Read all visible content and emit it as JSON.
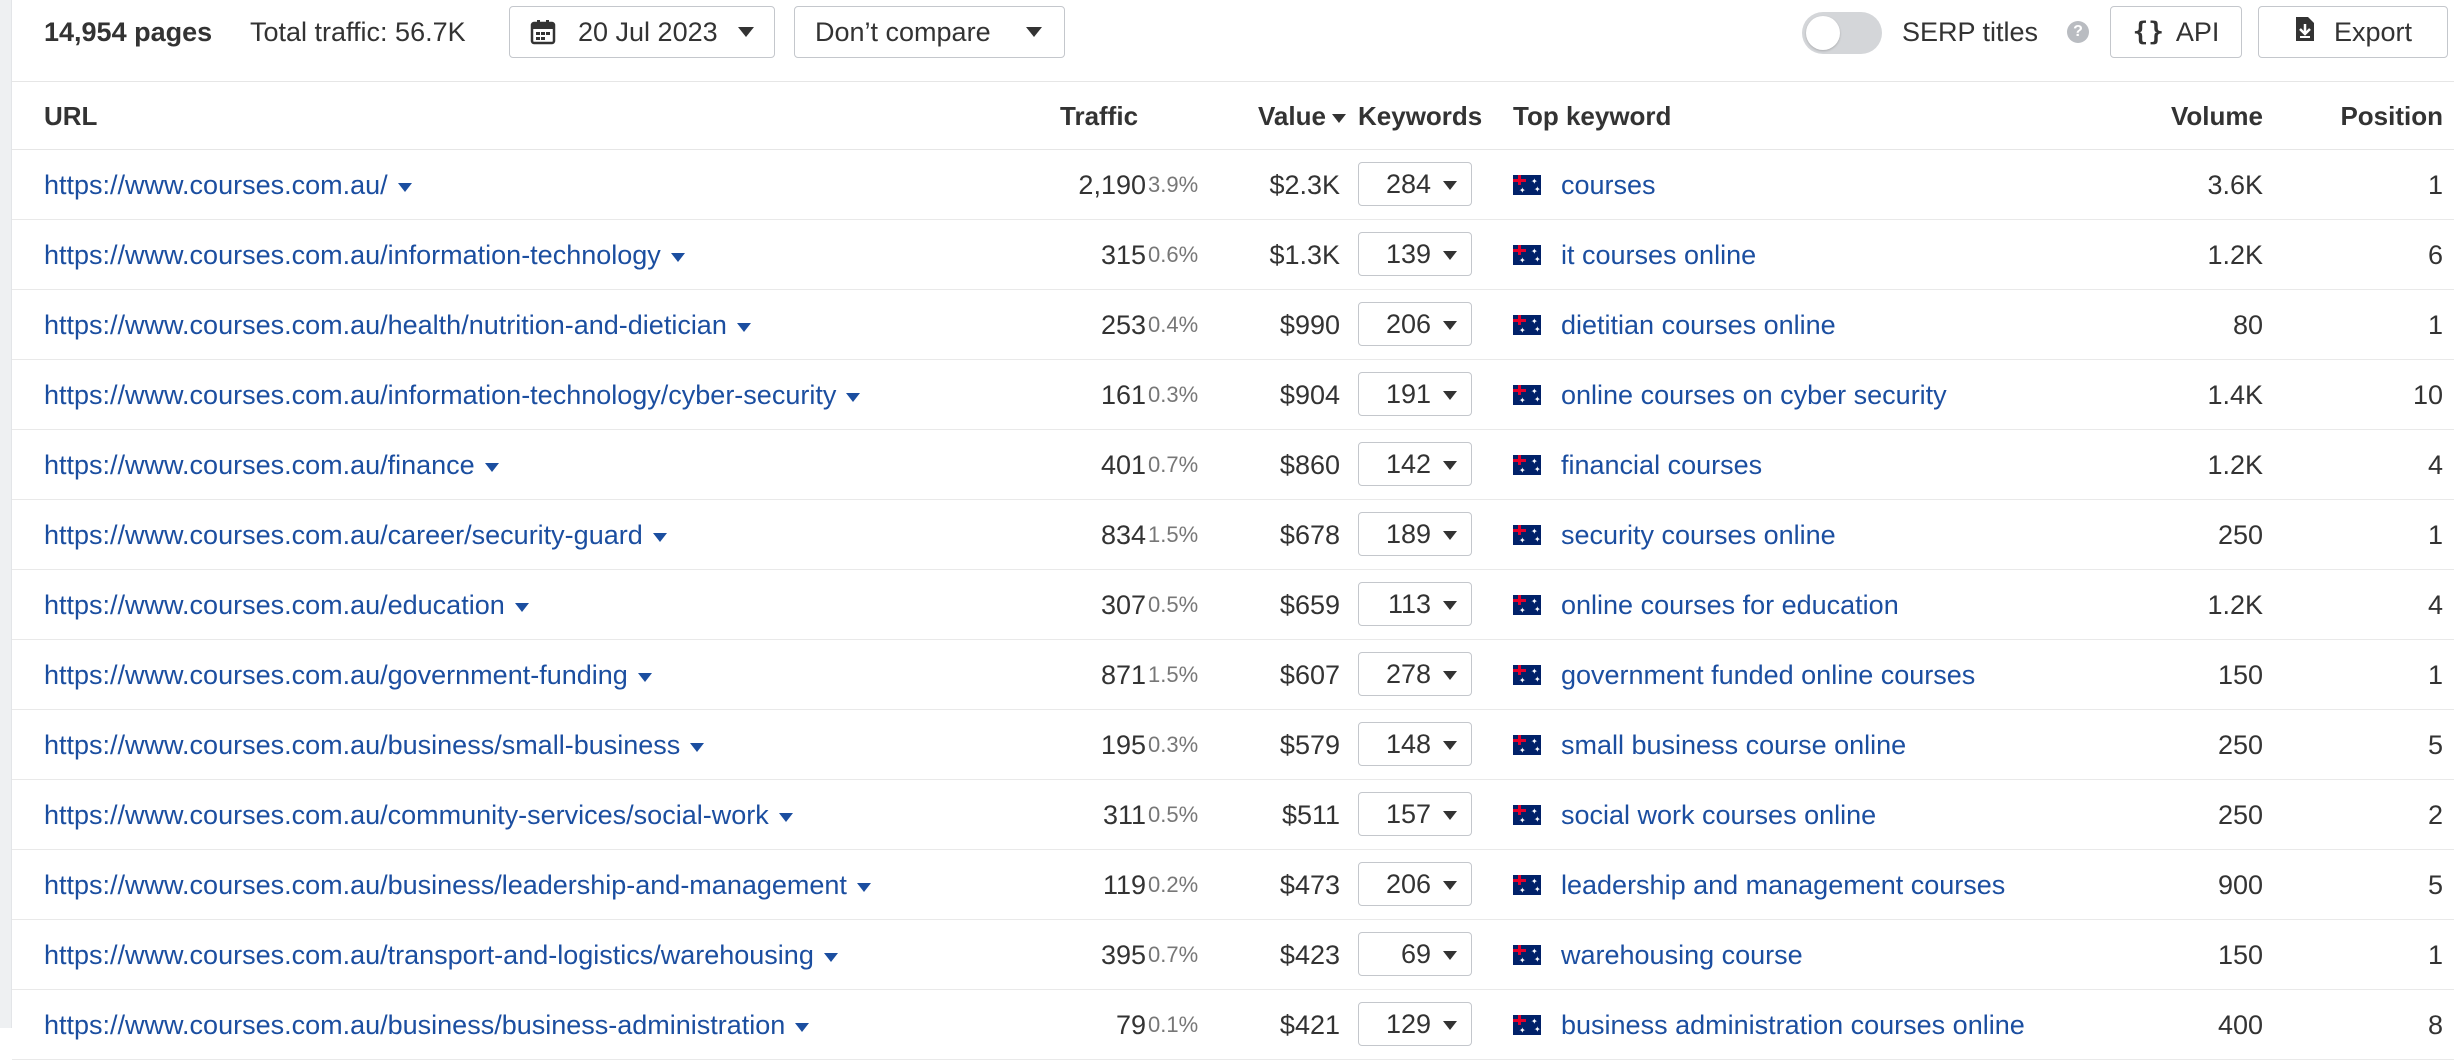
{
  "toolbar": {
    "pages_count": "14,954 pages",
    "total_traffic": "Total traffic: 56.7K",
    "date_label": "20 Jul 2023",
    "compare_label": "Don’t compare",
    "serp_titles_label": "SERP titles",
    "serp_titles_enabled": false,
    "help_icon_glyph": "?",
    "api_label": "API",
    "api_icon_glyph": "{}",
    "export_label": "Export"
  },
  "table": {
    "columns": {
      "url": "URL",
      "traffic": "Traffic",
      "value": "Value",
      "keywords": "Keywords",
      "top_keyword": "Top keyword",
      "volume": "Volume",
      "position": "Position"
    },
    "sort_column": "value",
    "sort_direction": "desc",
    "flag_icon": "australia-flag-icon",
    "rows": [
      {
        "url": "https://www.courses.com.au/",
        "traffic": "2,190",
        "traffic_pct": "3.9%",
        "value": "$2.3K",
        "keywords": "284",
        "top_keyword": "courses",
        "volume": "3.6K",
        "position": "1"
      },
      {
        "url": "https://www.courses.com.au/information-technology",
        "traffic": "315",
        "traffic_pct": "0.6%",
        "value": "$1.3K",
        "keywords": "139",
        "top_keyword": "it courses online",
        "volume": "1.2K",
        "position": "6"
      },
      {
        "url": "https://www.courses.com.au/health/nutrition-and-dietician",
        "traffic": "253",
        "traffic_pct": "0.4%",
        "value": "$990",
        "keywords": "206",
        "top_keyword": "dietitian courses online",
        "volume": "80",
        "position": "1"
      },
      {
        "url": "https://www.courses.com.au/information-technology/cyber-security",
        "traffic": "161",
        "traffic_pct": "0.3%",
        "value": "$904",
        "keywords": "191",
        "top_keyword": "online courses on cyber security",
        "volume": "1.4K",
        "position": "10"
      },
      {
        "url": "https://www.courses.com.au/finance",
        "traffic": "401",
        "traffic_pct": "0.7%",
        "value": "$860",
        "keywords": "142",
        "top_keyword": "financial courses",
        "volume": "1.2K",
        "position": "4"
      },
      {
        "url": "https://www.courses.com.au/career/security-guard",
        "traffic": "834",
        "traffic_pct": "1.5%",
        "value": "$678",
        "keywords": "189",
        "top_keyword": "security courses online",
        "volume": "250",
        "position": "1"
      },
      {
        "url": "https://www.courses.com.au/education",
        "traffic": "307",
        "traffic_pct": "0.5%",
        "value": "$659",
        "keywords": "113",
        "top_keyword": "online courses for education",
        "volume": "1.2K",
        "position": "4"
      },
      {
        "url": "https://www.courses.com.au/government-funding",
        "traffic": "871",
        "traffic_pct": "1.5%",
        "value": "$607",
        "keywords": "278",
        "top_keyword": "government funded online courses",
        "volume": "150",
        "position": "1"
      },
      {
        "url": "https://www.courses.com.au/business/small-business",
        "traffic": "195",
        "traffic_pct": "0.3%",
        "value": "$579",
        "keywords": "148",
        "top_keyword": "small business course online",
        "volume": "250",
        "position": "5"
      },
      {
        "url": "https://www.courses.com.au/community-services/social-work",
        "traffic": "311",
        "traffic_pct": "0.5%",
        "value": "$511",
        "keywords": "157",
        "top_keyword": "social work courses online",
        "volume": "250",
        "position": "2"
      },
      {
        "url": "https://www.courses.com.au/business/leadership-and-management",
        "traffic": "119",
        "traffic_pct": "0.2%",
        "value": "$473",
        "keywords": "206",
        "top_keyword": "leadership and management courses",
        "volume": "900",
        "position": "5"
      },
      {
        "url": "https://www.courses.com.au/transport-and-logistics/warehousing",
        "traffic": "395",
        "traffic_pct": "0.7%",
        "value": "$423",
        "keywords": "69",
        "top_keyword": "warehousing course",
        "volume": "150",
        "position": "1"
      },
      {
        "url": "https://www.courses.com.au/business/business-administration",
        "traffic": "79",
        "traffic_pct": "0.1%",
        "value": "$421",
        "keywords": "129",
        "top_keyword": "business administration courses online",
        "volume": "400",
        "position": "8"
      }
    ]
  },
  "colors": {
    "link": "#1b4ea0",
    "text": "#333333",
    "muted": "#777777",
    "border": "#c4c7cc",
    "toggle_off": "#d4d6d9"
  }
}
